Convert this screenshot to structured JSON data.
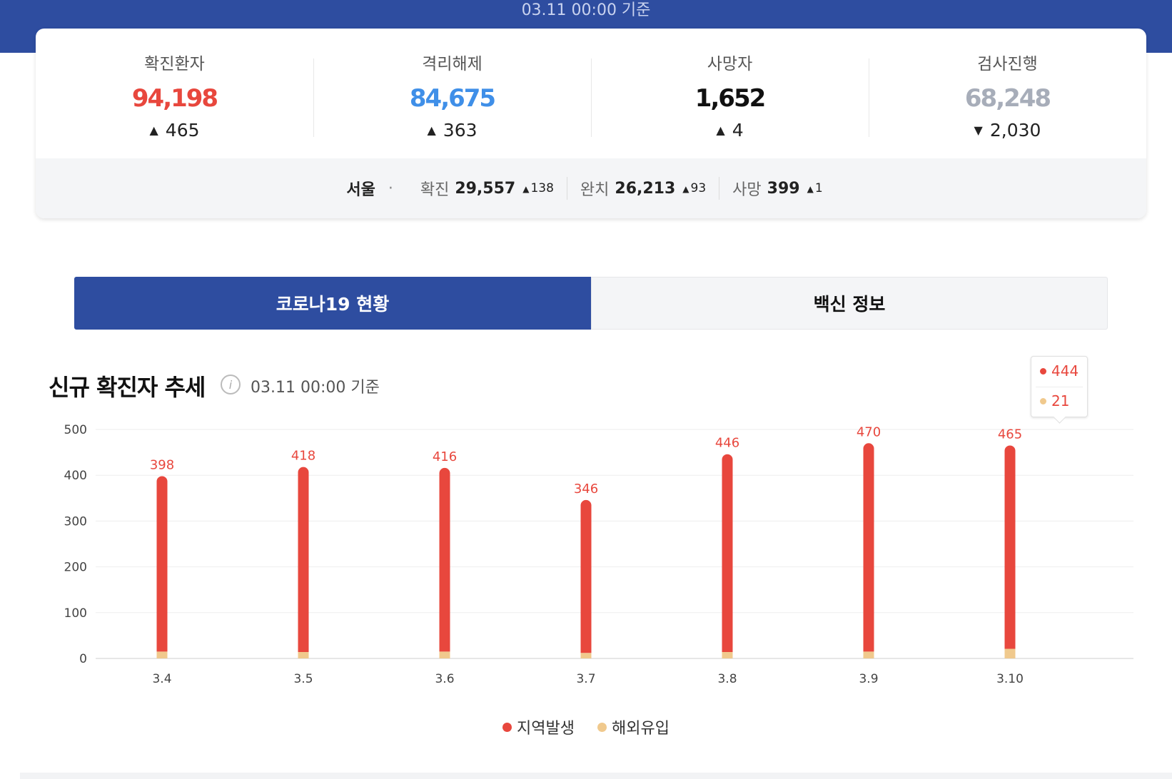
{
  "banner": {
    "date": "03.11 00:00 기준"
  },
  "stats": [
    {
      "label": "확진환자",
      "value": "94,198",
      "change": "465",
      "direction": "up",
      "color": "#e8473d"
    },
    {
      "label": "격리해제",
      "value": "84,675",
      "change": "363",
      "direction": "up",
      "color": "#3f8fe8"
    },
    {
      "label": "사망자",
      "value": "1,652",
      "change": "4",
      "direction": "up",
      "color": "#111111"
    },
    {
      "label": "검사진행",
      "value": "68,248",
      "change": "2,030",
      "direction": "down",
      "color": "#a7adb9"
    }
  ],
  "region": {
    "name": "서울",
    "items": [
      {
        "label": "확진",
        "value": "29,557",
        "delta": "138"
      },
      {
        "label": "완치",
        "value": "26,213",
        "delta": "93"
      },
      {
        "label": "사망",
        "value": "399",
        "delta": "1"
      }
    ]
  },
  "tabs": [
    {
      "label": "코로나19 현황",
      "active": true
    },
    {
      "label": "백신 정보",
      "active": false
    }
  ],
  "section": {
    "title": "신규 확진자 추세",
    "date": "03.11 00:00 기준"
  },
  "tooltip": {
    "local": "444",
    "imported": "21"
  },
  "colors": {
    "local": "#e8473d",
    "imported": "#f0c98d",
    "brand": "#2e4da0"
  },
  "chart_data": {
    "type": "bar",
    "stacked": true,
    "categories": [
      "3.4",
      "3.5",
      "3.6",
      "3.7",
      "3.8",
      "3.9",
      "3.10"
    ],
    "series": [
      {
        "name": "지역발생",
        "values": [
          383,
          404,
          401,
          334,
          432,
          455,
          444
        ]
      },
      {
        "name": "해외유입",
        "values": [
          15,
          14,
          15,
          12,
          14,
          15,
          21
        ]
      }
    ],
    "totals": [
      398,
      418,
      416,
      346,
      446,
      470,
      465
    ],
    "ylim": [
      0,
      500
    ],
    "yticks": [
      0,
      100,
      200,
      300,
      400,
      500
    ],
    "grid": true,
    "legend": "bottom-center"
  }
}
